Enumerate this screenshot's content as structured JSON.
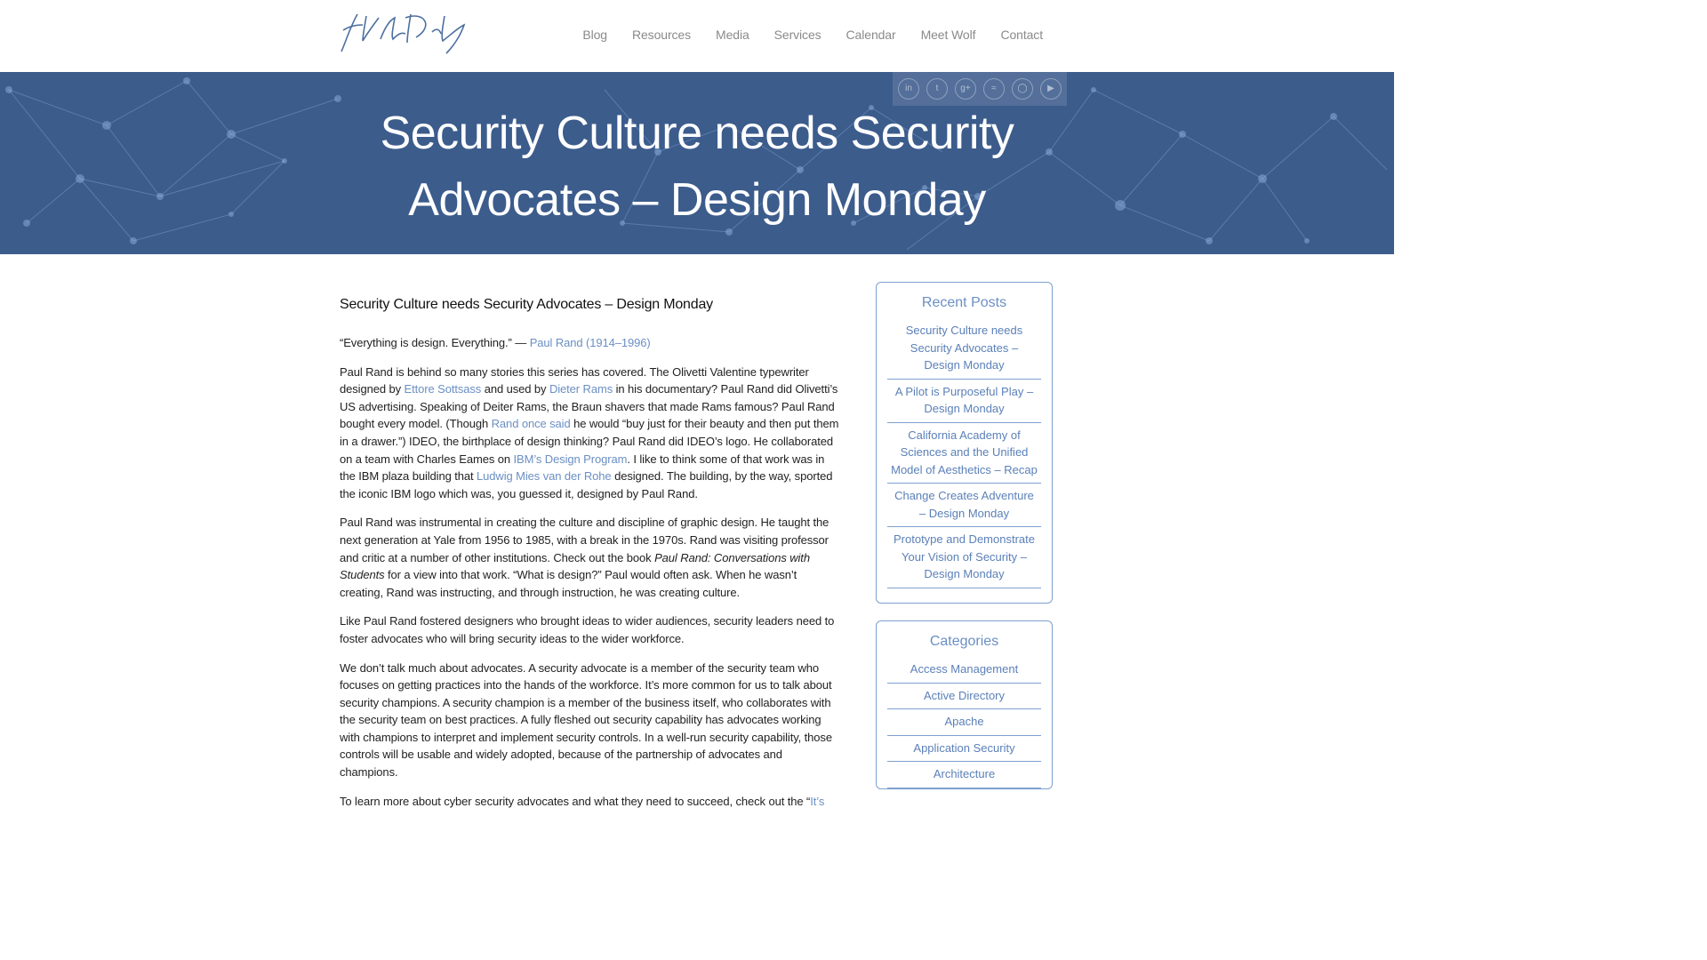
{
  "site": {
    "logo_alt": "signature-logo"
  },
  "nav": {
    "items": [
      "Blog",
      "Resources",
      "Media",
      "Services",
      "Calendar",
      "Meet Wolf",
      "Contact"
    ]
  },
  "hero": {
    "title_line1": "Security Culture needs Security",
    "title_line2": "Advocates – Design Monday",
    "social_icons": [
      "linkedin-icon",
      "twitter-icon",
      "google-plus-icon",
      "rss-icon",
      "instagram-icon",
      "youtube-icon"
    ]
  },
  "article": {
    "title": "Security Culture needs Security Advocates – Design Monday",
    "quote": "“Everything is design. Everything.” — ",
    "quote_link": "Paul Rand (1914–1996)",
    "p2": {
      "t1": "Paul Rand is behind so many stories this series has covered. The Olivetti Valentine typewriter designed by ",
      "l1": "Ettore Sottsass",
      "t2": " and used by ",
      "l2": "Dieter Rams",
      "t3": " in his documentary? Paul Rand did Olivetti’s US advertising. Speaking of Deiter Rams, the Braun shavers that made Rams famous? Paul Rand bought every model. (Though ",
      "l3": "Rand once said",
      "t4": " he would “buy just for their beauty and then put them in a drawer.”) IDEO, the birthplace of design thinking? Paul Rand did IDEO’s logo. He collaborated on a team with Charles Eames on ",
      "l4": "IBM’s Design Program",
      "t5": ". I like to think some of that work was in the IBM plaza building that ",
      "l5": "Ludwig Mies van der Rohe",
      "t6": " designed. The building, by the way, sported the iconic IBM logo which was, you guessed it, designed by Paul Rand."
    },
    "p3": {
      "t1": "Paul Rand was instrumental in creating the culture and discipline of graphic design. He taught the next generation at Yale from 1956 to 1985, with a break in the 1970s. Rand was visiting professor and critic at a number of other institutions. Check out the book ",
      "em": "Paul Rand: Conversations with Students",
      "t2": " for a view into that work. “What is design?” Paul would often ask. When he wasn’t creating, Rand was instructing, and through instruction, he was creating culture."
    },
    "p4": "Like Paul Rand fostered designers who brought ideas to wider audiences, security leaders need to foster advocates who will bring security ideas to the wider workforce.",
    "p5": "We don’t talk much about advocates. A security advocate is a member of the security team who focuses on getting practices into the hands of the workforce. It’s more common for us to talk about security champions. A security champion is a member of the business itself, who collaborates with the security team on best practices. A fully fleshed out security capability has advocates working with champions to interpret and implement security controls. In a well-run security capability, those controls will be usable and widely adopted, because of the partnership of advocates and champions.",
    "p6": {
      "t1": "To learn more about cyber security advocates and what they need to succeed, check out the “",
      "l1": "It’s"
    }
  },
  "sidebar": {
    "recent_title": "Recent Posts",
    "recent": [
      "Security Culture needs Security Advocates – Design Monday",
      "A Pilot is Purposeful Play – Design Monday",
      "California Academy of Sciences and the Unified Model of Aesthetics – Recap",
      "Change Creates Adventure – Design Monday",
      "Prototype and Demonstrate Your Vision of Security – Design Monday"
    ],
    "categories_title": "Categories",
    "categories": [
      "Access Management",
      "Active Directory",
      "Apache",
      "Application Security",
      "Architecture"
    ]
  },
  "colors": {
    "hero_bg": "#3c5c8c",
    "link": "#6b8fc4",
    "widget_border": "#7ea0cf"
  }
}
